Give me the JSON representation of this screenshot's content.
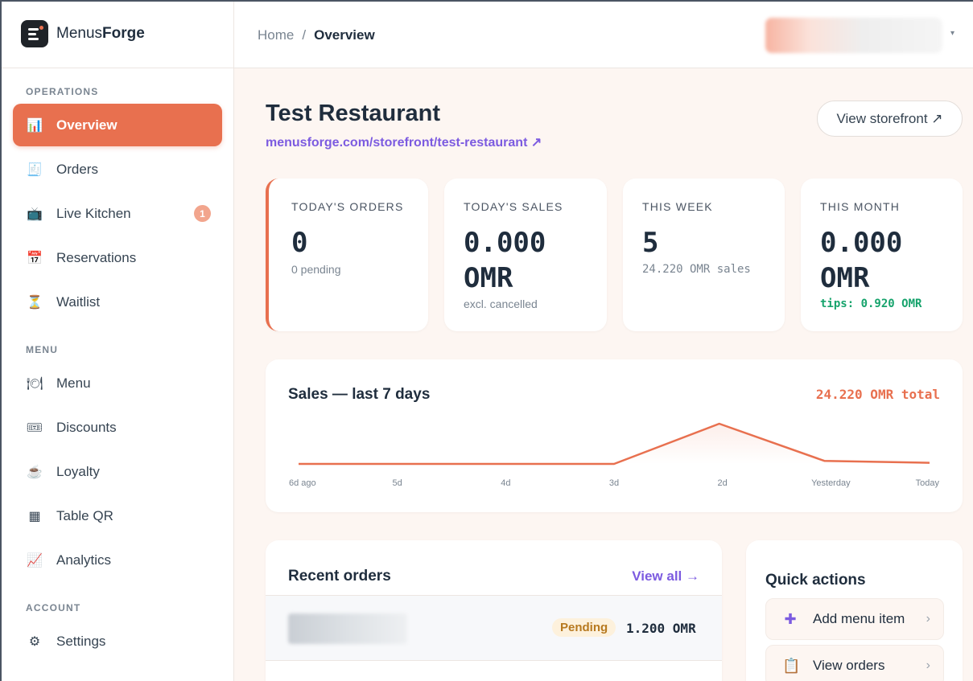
{
  "app": {
    "brand_prefix": "Menus",
    "brand_suffix": "Forge"
  },
  "sidebar": {
    "sections": [
      {
        "label": "OPERATIONS"
      },
      {
        "label": "MENU"
      },
      {
        "label": "ACCOUNT"
      }
    ],
    "items": [
      {
        "label": "Overview",
        "icon": "📊"
      },
      {
        "label": "Orders",
        "icon": "🧾"
      },
      {
        "label": "Live Kitchen",
        "icon": "📺",
        "badge": "1"
      },
      {
        "label": "Reservations",
        "icon": "📅"
      },
      {
        "label": "Waitlist",
        "icon": "⏳"
      },
      {
        "label": "Menu",
        "icon": "🍽"
      },
      {
        "label": "Discounts",
        "icon": "🎟"
      },
      {
        "label": "Loyalty",
        "icon": "☕"
      },
      {
        "label": "Table QR",
        "icon": "▦"
      },
      {
        "label": "Analytics",
        "icon": "📈"
      },
      {
        "label": "Settings",
        "icon": "⚙"
      }
    ]
  },
  "header": {
    "breadcrumb_home": "Home",
    "breadcrumb_sep": "/",
    "breadcrumb_current": "Overview",
    "user_caret": "▾"
  },
  "page": {
    "title": "Test Restaurant",
    "storefront_link": "menusforge.com/storefront/test-restaurant ↗",
    "view_storefront": "View storefront ↗"
  },
  "stats": [
    {
      "label": "TODAY'S ORDERS",
      "value": "0",
      "sub": "0 pending"
    },
    {
      "label": "TODAY'S SALES",
      "value_line1": "0.000",
      "value_line2": "OMR",
      "sub": "excl. cancelled"
    },
    {
      "label": "THIS WEEK",
      "value": "5",
      "sub": "24.220 OMR sales"
    },
    {
      "label": "THIS MONTH",
      "value_line1": "0.000",
      "value_line2": "OMR",
      "sub": "tips: 0.920 OMR"
    }
  ],
  "sales_chart": {
    "title": "Sales — last 7 days",
    "total": "24.220 OMR total"
  },
  "chart_data": {
    "type": "line",
    "x": [
      "6d ago",
      "5d",
      "4d",
      "3d",
      "2d",
      "Yesterday",
      "Today"
    ],
    "series": [
      {
        "values": [
          0,
          0,
          0,
          0,
          21.0,
          1.6,
          0.6
        ]
      }
    ],
    "color": "#e8704f",
    "grid": false
  },
  "recent_orders": {
    "title": "Recent orders",
    "view_all": "View all →",
    "rows": [
      {
        "status": "Pending",
        "amount": "1.200 OMR"
      }
    ]
  },
  "quick_actions": {
    "title": "Quick actions",
    "items": [
      {
        "label": "Add menu item",
        "icon": "➕"
      },
      {
        "label": "View orders",
        "icon": "📋"
      }
    ],
    "chevron": "›"
  },
  "colors": {
    "accent": "#e8704f",
    "link": "#7c5be0",
    "success": "#16a36c",
    "pending_bg": "#fdf1dc",
    "pending_fg": "#b7791f"
  }
}
